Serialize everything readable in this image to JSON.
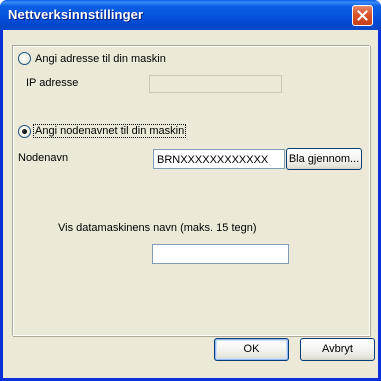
{
  "window": {
    "title": "Nettverksinnstillinger",
    "close_icon": "close-icon"
  },
  "options": {
    "address": {
      "label": "Angi adresse til din maskin",
      "selected": false,
      "ip_label": "IP adresse",
      "ip_value": ""
    },
    "nodename": {
      "label": "Angi nodenavnet til din maskin",
      "selected": true,
      "node_label": "Nodenavn",
      "node_value": "BRNXXXXXXXXXXXX",
      "browse_label": "Bla gjennom..."
    }
  },
  "computer_name": {
    "label": "Vis datamaskinens navn (maks. 15 tegn)",
    "value": ""
  },
  "buttons": {
    "ok": "OK",
    "cancel": "Avbryt"
  },
  "colors": {
    "titlebar": "#0054e3",
    "dialog_bg": "#ece9d8",
    "close_button": "#d9532b"
  }
}
